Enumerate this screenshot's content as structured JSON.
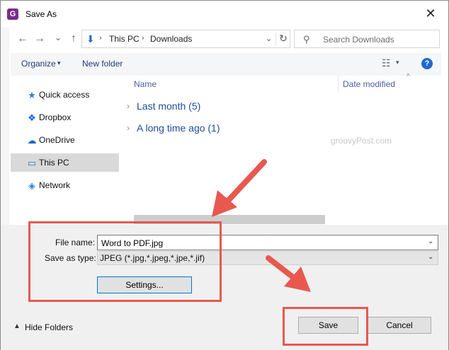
{
  "window": {
    "title": "Save As",
    "app_icon_letter": "G",
    "close_glyph": "✕"
  },
  "nav": {
    "back": "←",
    "forward": "→",
    "recent": "⌄",
    "up": "↑"
  },
  "address": {
    "icon": "⬇",
    "crumbs": [
      "This PC",
      "Downloads"
    ],
    "separator": "›",
    "chevron": "⌄",
    "refresh": "↻"
  },
  "search": {
    "placeholder": "Search Downloads",
    "icon": "⚲"
  },
  "toolbar": {
    "organize": "Organize",
    "organize_chevron": "▾",
    "new_folder": "New folder",
    "view_icon": "☷",
    "view_chevron": "▾",
    "help": "?"
  },
  "sidebar": {
    "items": [
      {
        "label": "Quick access",
        "icon": "★",
        "icon_color": "#3a7bd5"
      },
      {
        "label": "Dropbox",
        "icon": "❖",
        "icon_color": "#0061fe"
      },
      {
        "label": "OneDrive",
        "icon": "☁",
        "icon_color": "#0f6cbd"
      },
      {
        "label": "This PC",
        "icon": "▭",
        "icon_color": "#2a7ad5"
      },
      {
        "label": "Network",
        "icon": "◈",
        "icon_color": "#2b82d9"
      }
    ],
    "selected_index": 3
  },
  "filelist": {
    "columns": [
      "Name",
      "Date modified"
    ],
    "sort_chevron": "^",
    "groups": [
      {
        "label": "Last month (5)",
        "chevron": "›"
      },
      {
        "label": "A long time ago (1)",
        "chevron": "›"
      }
    ],
    "watermark": "groovyPost.com"
  },
  "form": {
    "file_name_label": "File name:",
    "file_name_value": "Word to PDF.jpg",
    "save_type_label": "Save as type:",
    "save_type_value": "JPEG (*.jpg,*.jpeg,*.jpe,*.jif)",
    "dropdown_chevron": "⌄"
  },
  "buttons": {
    "settings": "Settings...",
    "save": "Save",
    "cancel": "Cancel",
    "hide_folders": "Hide Folders",
    "hide_folders_chevron": "▲"
  },
  "annotation": {
    "color": "#e8584f"
  }
}
